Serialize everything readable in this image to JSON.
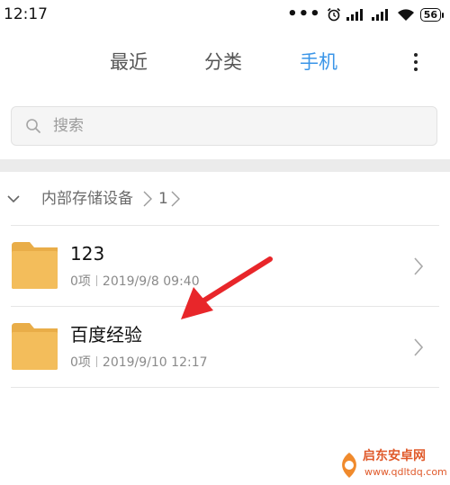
{
  "status_bar": {
    "time": "12:17",
    "dots": "•••",
    "battery": "56"
  },
  "tabs": [
    {
      "label": "最近",
      "active": false
    },
    {
      "label": "分类",
      "active": false
    },
    {
      "label": "手机",
      "active": true
    }
  ],
  "search": {
    "placeholder": "搜索"
  },
  "breadcrumb": {
    "root": "内部存储设备",
    "current": "1"
  },
  "items": [
    {
      "title": "123",
      "count": "0项",
      "date": "2019/9/8 09:40"
    },
    {
      "title": "百度经验",
      "count": "0项",
      "date": "2019/9/10 12:17"
    }
  ],
  "colors": {
    "accent": "#3a95e8",
    "folder": "#f3bd5b",
    "arrow": "#e8262a"
  },
  "watermark": {
    "title": "启东安卓网",
    "url": "www.qdltdq.com"
  }
}
